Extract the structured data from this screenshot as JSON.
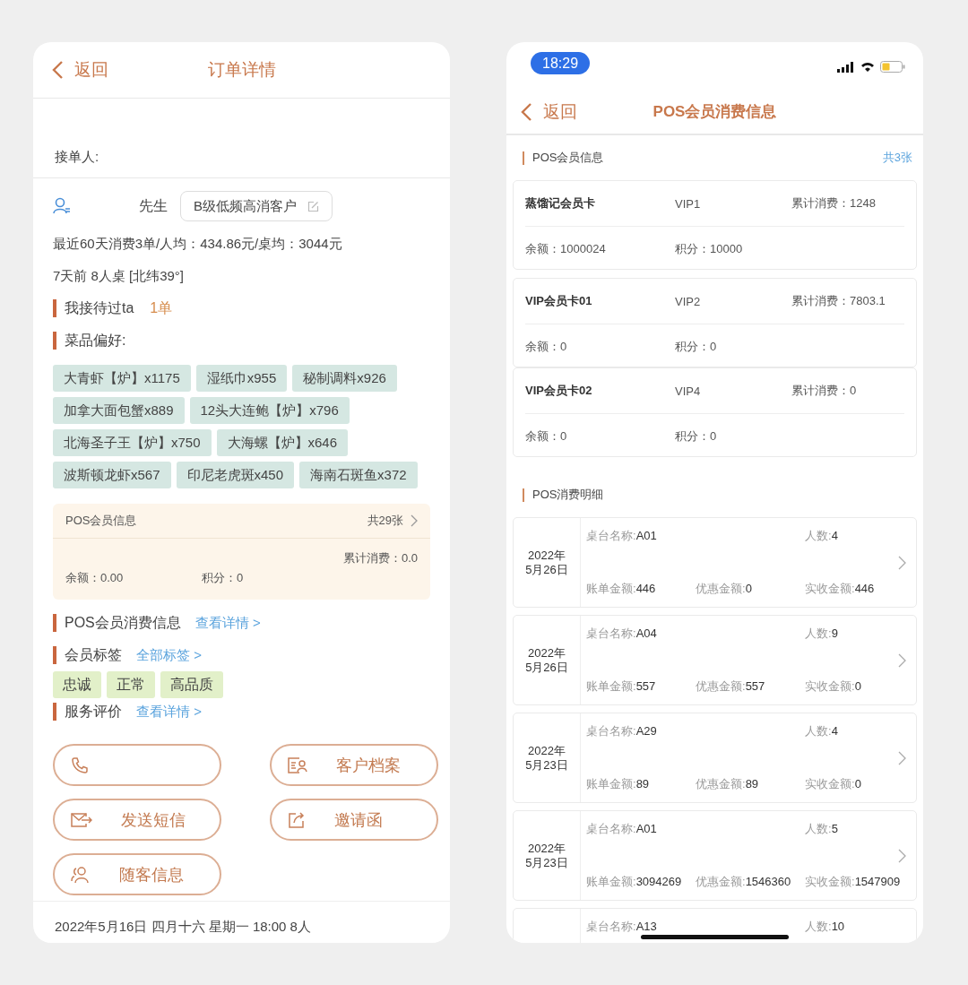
{
  "left": {
    "nav": {
      "back": "返回",
      "title": "订单详情"
    },
    "receiver": {
      "label": "接单人:"
    },
    "customer": {
      "salutation": "先生",
      "tag": "B级低频高消客户"
    },
    "stats": "最近60天消费3单/人均：434.86元/桌均：3044元",
    "last_visit": "7天前 8人桌 [北纬39°]",
    "served": {
      "label": "我接待过ta",
      "count": "1单"
    },
    "dish_heading": "菜品偏好:",
    "dishes": [
      "大青虾【炉】x1175",
      "湿纸巾x955",
      "秘制调料x926",
      "加拿大面包蟹x889",
      "12头大连鲍【炉】x796",
      "北海圣子王【炉】x750",
      "大海螺【炉】x646",
      "波斯顿龙虾x567",
      "印尼老虎斑x450",
      "海南石斑鱼x372"
    ],
    "pos_card": {
      "title": "POS会员信息",
      "count": "共29张",
      "total": "累计消费：0.0",
      "balance": "余额：0.00",
      "points": "积分：0"
    },
    "consumption": {
      "label": "POS会员消费信息",
      "link": "查看详情 >"
    },
    "member_tags": {
      "label": "会员标签",
      "link": "全部标签 >",
      "tags": [
        "忠诚",
        "正常",
        "高品质"
      ]
    },
    "service_review": {
      "label": "服务评价",
      "link": "查看详情 >"
    },
    "actions": [
      {
        "kind": "phone"
      },
      {
        "kind": "profile",
        "label": "客户档案"
      },
      {
        "kind": "sms",
        "label": "发送短信"
      },
      {
        "kind": "invite",
        "label": "邀请函"
      },
      {
        "kind": "companion",
        "label": "随客信息"
      }
    ],
    "footer": "2022年5月16日 四月十六 星期一 18:00 8人"
  },
  "right": {
    "status_bar": {
      "time": "18:29"
    },
    "nav": {
      "back": "返回",
      "title": "POS会员消费信息"
    },
    "cards_heading": {
      "label": "POS会员信息",
      "count": "共3张"
    },
    "cards": [
      {
        "name": "蒸馏记会员卡",
        "tier": "VIP1",
        "total": "累计消费：1248",
        "balance": "余额：1000024",
        "points": "积分：10000"
      },
      {
        "name": "VIP会员卡01",
        "tier": "VIP2",
        "total": "累计消费：7803.1",
        "balance": "余额：0",
        "points": "积分：0"
      },
      {
        "name": "VIP会员卡02",
        "tier": "VIP4",
        "total": "累计消费：0",
        "balance": "余额：0",
        "points": "积分：0"
      }
    ],
    "records_heading": "POS消费明细",
    "records": [
      {
        "date_lines": [
          "2022年",
          "5月26日"
        ],
        "table": {
          "label": "桌台名称:",
          "value": "A01"
        },
        "people": {
          "label": "人数:",
          "value": "4"
        },
        "bill": {
          "label": "账单金额:",
          "value": "446"
        },
        "discount": {
          "label": "优惠金额:",
          "value": "0"
        },
        "received": {
          "label": "实收金额:",
          "value": "446"
        }
      },
      {
        "date_lines": [
          "2022年",
          "5月26日"
        ],
        "table": {
          "label": "桌台名称:",
          "value": "A04"
        },
        "people": {
          "label": "人数:",
          "value": "9"
        },
        "bill": {
          "label": "账单金额:",
          "value": "557"
        },
        "discount": {
          "label": "优惠金额:",
          "value": "557"
        },
        "received": {
          "label": "实收金额:",
          "value": "0"
        }
      },
      {
        "date_lines": [
          "2022年",
          "5月23日"
        ],
        "table": {
          "label": "桌台名称:",
          "value": "A29"
        },
        "people": {
          "label": "人数:",
          "value": "4"
        },
        "bill": {
          "label": "账单金额:",
          "value": "89"
        },
        "discount": {
          "label": "优惠金额:",
          "value": "89"
        },
        "received": {
          "label": "实收金额:",
          "value": "0"
        }
      },
      {
        "date_lines": [
          "2022年",
          "5月23日"
        ],
        "table": {
          "label": "桌台名称:",
          "value": "A01"
        },
        "people": {
          "label": "人数:",
          "value": "5"
        },
        "bill": {
          "label": "账单金额:",
          "value": "3094269"
        },
        "discount": {
          "label": "优惠金额:",
          "value": "1546360"
        },
        "received": {
          "label": "实收金额:",
          "value": "1547909"
        }
      },
      {
        "table": {
          "label": "桌台名称:",
          "value": "A13"
        },
        "people": {
          "label": "人数:",
          "value": "10"
        }
      }
    ]
  }
}
